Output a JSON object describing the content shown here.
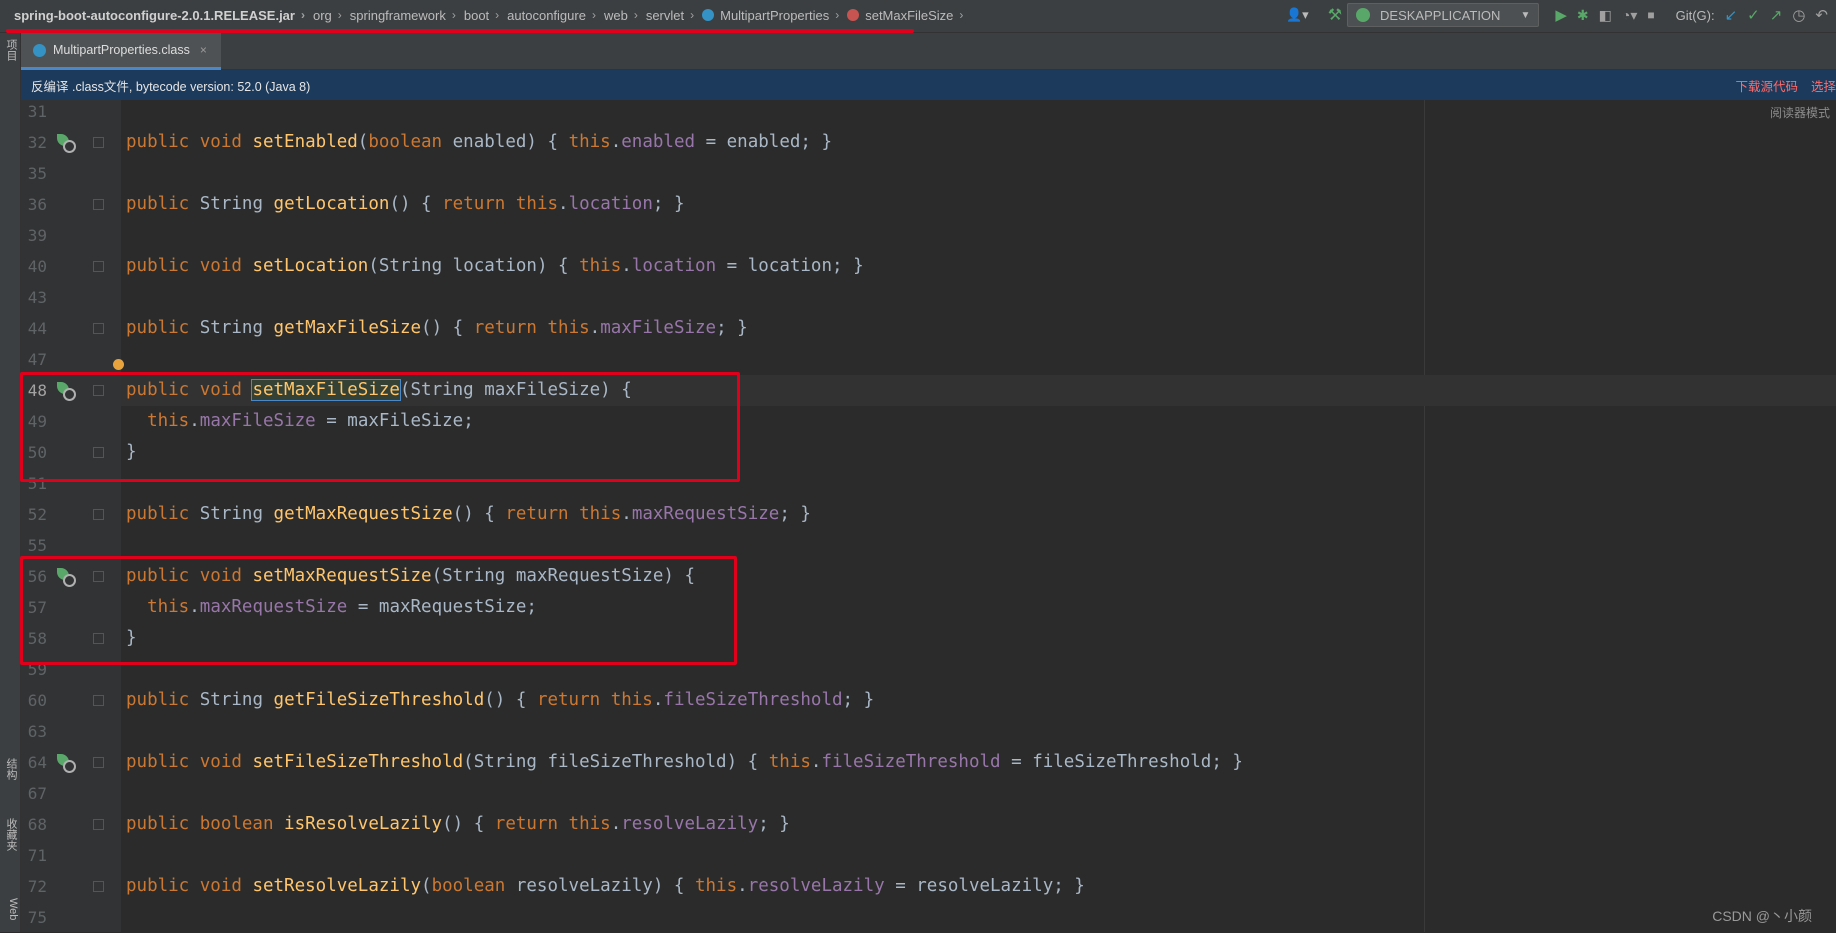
{
  "breadcrumbs": [
    {
      "label": "spring-boot-autoconfigure-2.0.1.RELEASE.jar",
      "icon": ""
    },
    {
      "label": "org",
      "icon": ""
    },
    {
      "label": "springframework",
      "icon": ""
    },
    {
      "label": "boot",
      "icon": ""
    },
    {
      "label": "autoconfigure",
      "icon": ""
    },
    {
      "label": "web",
      "icon": ""
    },
    {
      "label": "servlet",
      "icon": ""
    },
    {
      "label": "MultipartProperties",
      "icon": "class-icon"
    },
    {
      "label": "setMaxFileSize",
      "icon": "method-icon"
    }
  ],
  "toolbar": {
    "run_config": "DESKAPPLICATION",
    "git_label": "Git(G):"
  },
  "left_strip": {
    "project": "项目",
    "structure": "结构",
    "favorites": "收藏夹",
    "web": "Web"
  },
  "tab": {
    "label": "MultipartProperties.class",
    "close": "×"
  },
  "banner": {
    "message": "反编译 .class文件, bytecode version: 52.0 (Java 8)",
    "download": "下载源代码",
    "select": "选择"
  },
  "reader_mode": "阅读器模式",
  "watermark": "CSDN @丶小颜",
  "colors": {
    "keyword": "#cc7832",
    "method": "#ffc66d",
    "field": "#9876aa",
    "highlight_box": "#e0001b",
    "banner_bg": "#1c3a5c"
  },
  "code_lines": [
    {
      "n": "31",
      "t": ""
    },
    {
      "n": "32",
      "t": "public void setEnabled(boolean enabled) { this.enabled = enabled; }"
    },
    {
      "n": "35",
      "t": ""
    },
    {
      "n": "36",
      "t": "public String getLocation() { return this.location; }"
    },
    {
      "n": "39",
      "t": ""
    },
    {
      "n": "40",
      "t": "public void setLocation(String location) { this.location = location; }"
    },
    {
      "n": "43",
      "t": ""
    },
    {
      "n": "44",
      "t": "public String getMaxFileSize() { return this.maxFileSize; }"
    },
    {
      "n": "47",
      "t": ""
    },
    {
      "n": "48",
      "t": "public void setMaxFileSize(String maxFileSize) {"
    },
    {
      "n": "49",
      "t": "  this.maxFileSize = maxFileSize;"
    },
    {
      "n": "50",
      "t": "}"
    },
    {
      "n": "51",
      "t": ""
    },
    {
      "n": "52",
      "t": "public String getMaxRequestSize() { return this.maxRequestSize; }"
    },
    {
      "n": "55",
      "t": ""
    },
    {
      "n": "56",
      "t": "public void setMaxRequestSize(String maxRequestSize) {"
    },
    {
      "n": "57",
      "t": "  this.maxRequestSize = maxRequestSize;"
    },
    {
      "n": "58",
      "t": "}"
    },
    {
      "n": "59",
      "t": ""
    },
    {
      "n": "60",
      "t": "public String getFileSizeThreshold() { return this.fileSizeThreshold; }"
    },
    {
      "n": "63",
      "t": ""
    },
    {
      "n": "64",
      "t": "public void setFileSizeThreshold(String fileSizeThreshold) { this.fileSizeThreshold = fileSizeThreshold; }"
    },
    {
      "n": "67",
      "t": ""
    },
    {
      "n": "68",
      "t": "public boolean isResolveLazily() { return this.resolveLazily; }"
    },
    {
      "n": "71",
      "t": ""
    },
    {
      "n": "72",
      "t": "public void setResolveLazily(boolean resolveLazily) { this.resolveLazily = resolveLazily; }"
    },
    {
      "n": "75",
      "t": ""
    }
  ]
}
